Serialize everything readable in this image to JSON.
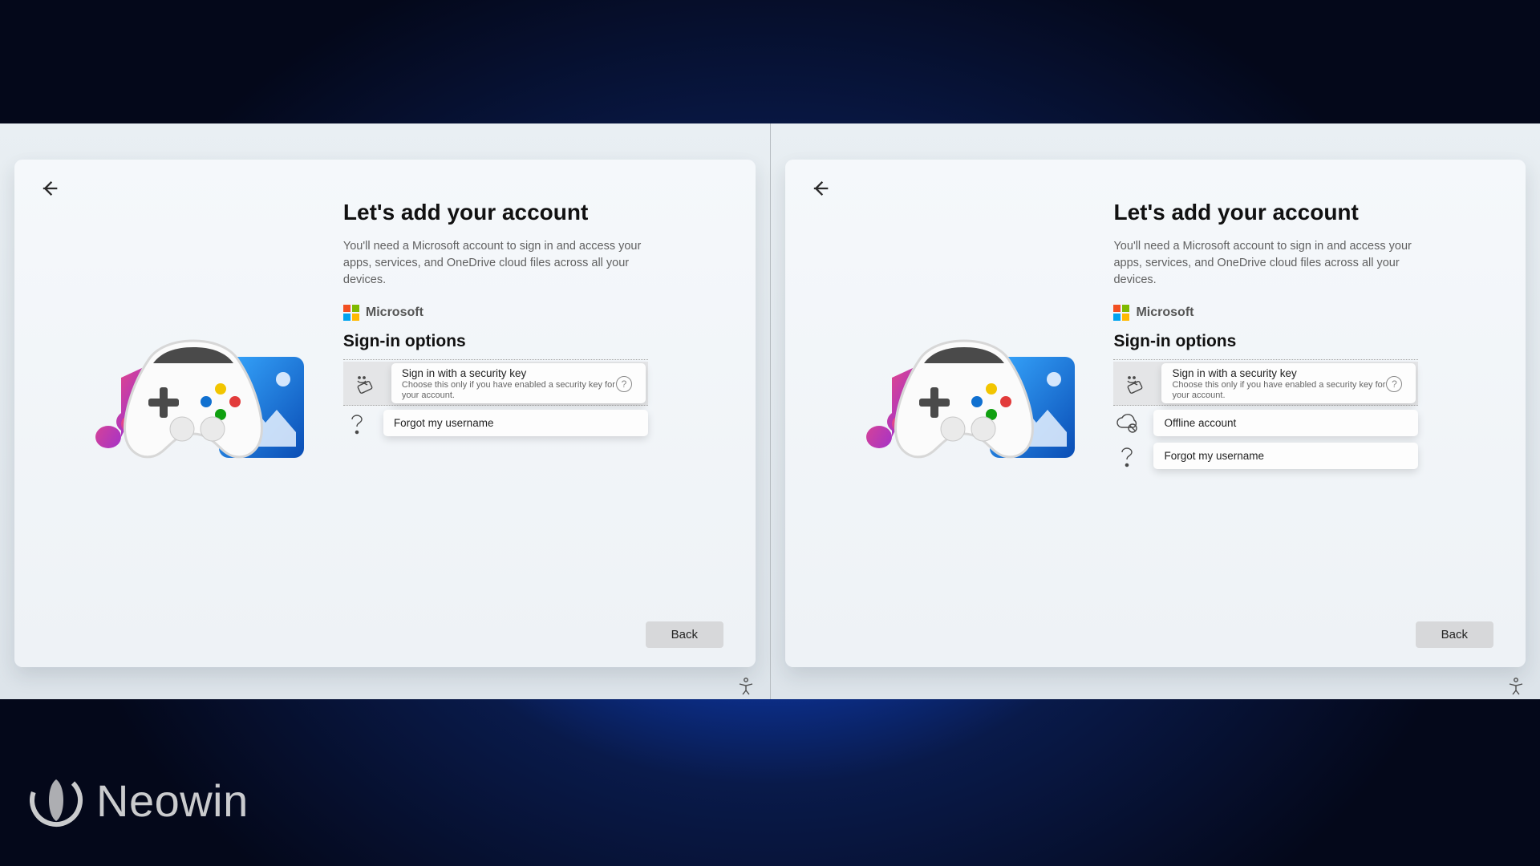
{
  "common": {
    "heading": "Let's add your account",
    "subtitle": "You'll need a Microsoft account to sign in and access your apps, services, and OneDrive cloud files across all your devices.",
    "brand": "Microsoft",
    "section_heading": "Sign-in options",
    "back_button": "Back",
    "security_key": {
      "title": "Sign in with a security key",
      "desc": "Choose this only if you have enabled a security key for your account."
    },
    "offline_account": {
      "title": "Offline account"
    },
    "forgot_username": {
      "title": "Forgot my username"
    }
  },
  "watermark": {
    "text": "Neowin"
  },
  "colors": {
    "ms_red": "#f25022",
    "ms_green": "#7fba00",
    "ms_blue": "#00a4ef",
    "ms_yellow": "#ffb900"
  }
}
